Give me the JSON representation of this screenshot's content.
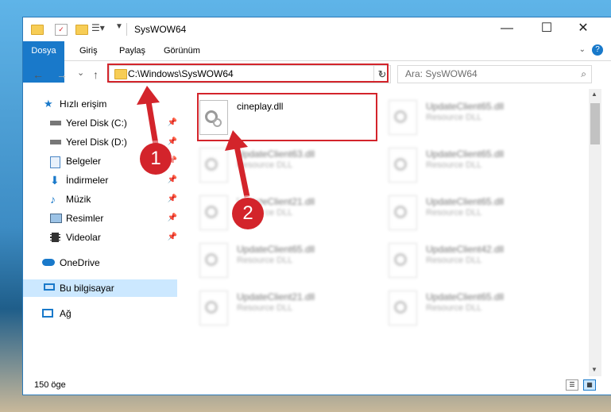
{
  "window": {
    "title": "SysWOW64",
    "minimize_glyph": "—",
    "maximize_glyph": "☐",
    "close_glyph": "✕"
  },
  "ribbon": {
    "tabs": [
      "Dosya",
      "Giriş",
      "Paylaş",
      "Görünüm"
    ],
    "help_glyph": "?"
  },
  "nav": {
    "back_glyph": "←",
    "forward_glyph": "→",
    "recent_glyph": "⌄",
    "up_glyph": "↑",
    "address": "C:\\Windows\\SysWOW64",
    "refresh_glyph": "↻",
    "search_placeholder": "Ara: SysWOW64"
  },
  "sidebar": {
    "items": [
      {
        "label": "Hızlı erişim",
        "icon": "star-icon",
        "pinned": false
      },
      {
        "label": "Yerel Disk (C:)",
        "icon": "drive-icon",
        "pinned": true
      },
      {
        "label": "Yerel Disk (D:)",
        "icon": "drive-icon",
        "pinned": true
      },
      {
        "label": "Belgeler",
        "icon": "documents-icon",
        "pinned": true
      },
      {
        "label": "İndirmeler",
        "icon": "download-icon",
        "pinned": true
      },
      {
        "label": "Müzik",
        "icon": "music-icon",
        "pinned": true
      },
      {
        "label": "Resimler",
        "icon": "pictures-icon",
        "pinned": true
      },
      {
        "label": "Videolar",
        "icon": "video-icon",
        "pinned": true
      },
      {
        "label": "OneDrive",
        "icon": "cloud-icon",
        "pinned": false
      },
      {
        "label": "Bu bilgisayar",
        "icon": "computer-icon",
        "pinned": false
      },
      {
        "label": "Ağ",
        "icon": "network-icon",
        "pinned": false
      }
    ],
    "pin_glyph": "📌"
  },
  "files": [
    {
      "name": "cineplay.dll",
      "type": ""
    },
    {
      "name": "UpdateClient65.dll",
      "type": "Resource DLL"
    },
    {
      "name": "UpdateClient63.dll",
      "type": "Resource DLL"
    },
    {
      "name": "UpdateClient65.dll",
      "type": "Resource DLL"
    },
    {
      "name": "UpdateClient21.dll",
      "type": "Resource DLL"
    },
    {
      "name": "UpdateClient65.dll",
      "type": "Resource DLL"
    },
    {
      "name": "UpdateClient65.dll",
      "type": "Resource DLL"
    },
    {
      "name": "UpdateClient42.dll",
      "type": "Resource DLL"
    },
    {
      "name": "UpdateClient21.dll",
      "type": "Resource DLL"
    },
    {
      "name": "UpdateClient65.dll",
      "type": "Resource DLL"
    }
  ],
  "status": {
    "item_count": "150 öge"
  },
  "annotations": {
    "step1": "1",
    "step2": "2",
    "color": "#d3242b"
  }
}
